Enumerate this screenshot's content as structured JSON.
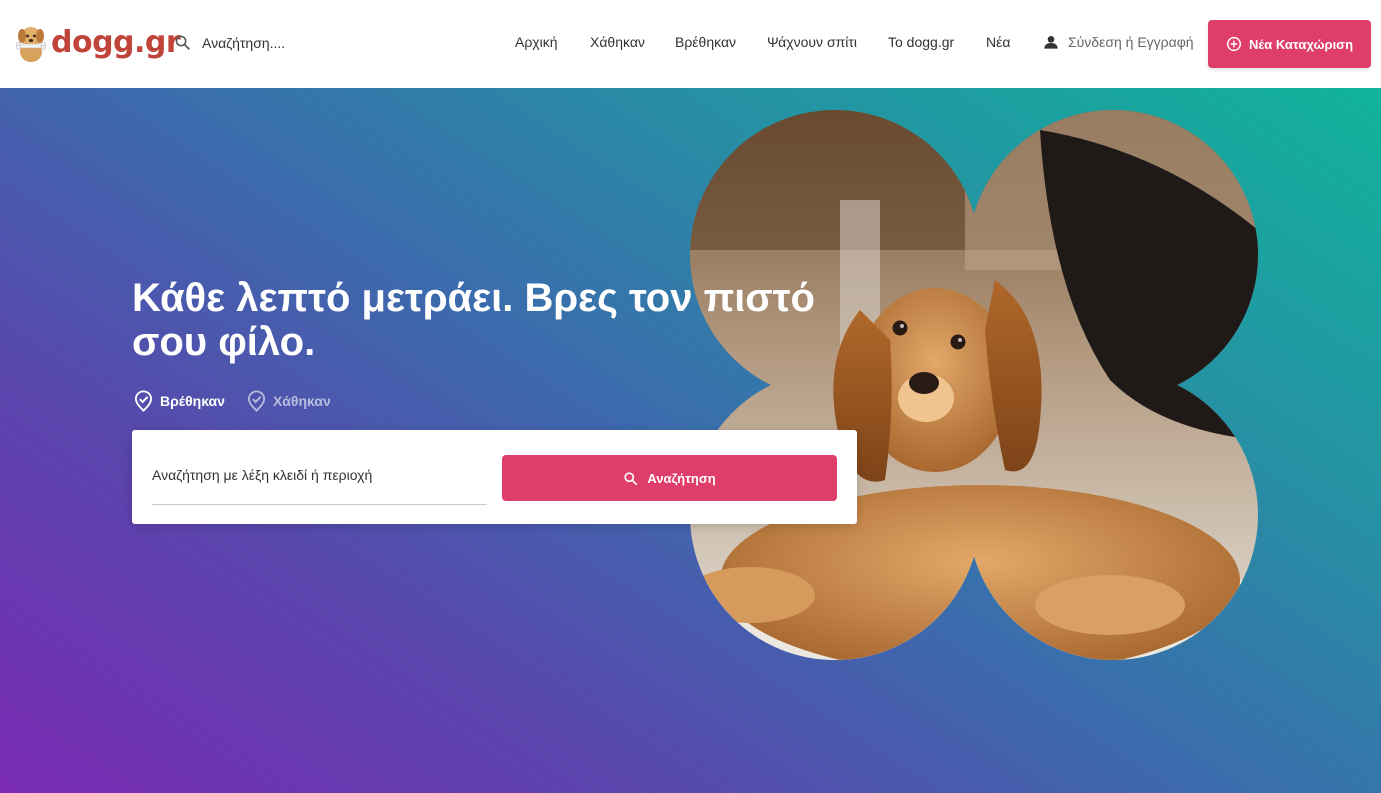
{
  "brand": {
    "name": "dogg.gr",
    "accent": "#df3d6a",
    "logo_color": "#c0443a"
  },
  "header": {
    "search": {
      "placeholder": "Αναζήτηση....",
      "icon": "search-icon"
    },
    "nav": [
      {
        "label": "Αρχική"
      },
      {
        "label": "Χάθηκαν"
      },
      {
        "label": "Βρέθηκαν"
      },
      {
        "label": "Ψάχνουν σπίτι"
      },
      {
        "label": "To dogg.gr"
      },
      {
        "label": "Νέα"
      }
    ],
    "login": {
      "label": "Σύνδεση ή Εγγραφή",
      "icon": "user-icon"
    },
    "cta": {
      "label": "Νέα Καταχώριση",
      "icon": "plus-circle-icon"
    }
  },
  "hero": {
    "headline": "Κάθε λεπτό μετράει. Βρες τον πιστό σου φίλο.",
    "filters": [
      {
        "label": "Βρέθηκαν",
        "active": true,
        "icon": "check-badge-icon"
      },
      {
        "label": "Χάθηκαν",
        "active": false,
        "icon": "check-badge-icon"
      }
    ],
    "search": {
      "placeholder": "Αναζήτηση με λέξη κλειδί ή περιοχή",
      "button_label": "Αναζήτηση",
      "icon": "search-icon"
    },
    "gradient": {
      "start": "#7a2bb3",
      "mid": "#3b6cad",
      "end": "#11b39c"
    }
  }
}
